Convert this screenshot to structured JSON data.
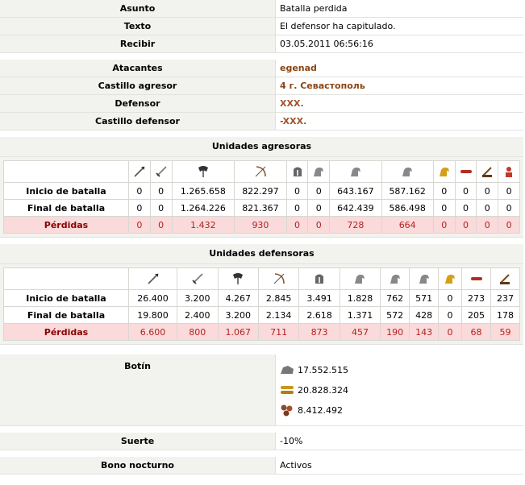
{
  "header": {
    "subject_label": "Asunto",
    "subject_value": "Batalla perdida",
    "text_label": "Texto",
    "text_value": "El defensor ha capitulado.",
    "received_label": "Recibir",
    "received_value": "03.05.2011 06:56:16"
  },
  "battle": {
    "attackers_label": "Atacantes",
    "attackers_value": "egenad",
    "attacker_castle_label": "Castillo agresor",
    "attacker_castle_value": "4 г. Севастополь",
    "defender_label": "Defensor",
    "defender_value": "XXX.",
    "defender_castle_label": "Castillo defensor",
    "defender_castle_value": "-XXX."
  },
  "attack_units": {
    "title": "Unidades agresoras",
    "icons": [
      "spear-icon",
      "sword-icon",
      "axe-icon",
      "bow-icon",
      "helmet-icon",
      "horse-icon",
      "horse-icon",
      "horse-icon",
      "horse-gold-icon",
      "ram-icon",
      "catapult-icon",
      "knight-icon"
    ],
    "rows": [
      {
        "label": "Inicio de batalla",
        "values": [
          "0",
          "0",
          "1.265.658",
          "822.297",
          "0",
          "0",
          "643.167",
          "587.162",
          "0",
          "0",
          "0",
          "0"
        ]
      },
      {
        "label": "Final de batalla",
        "values": [
          "0",
          "0",
          "1.264.226",
          "821.367",
          "0",
          "0",
          "642.439",
          "586.498",
          "0",
          "0",
          "0",
          "0"
        ]
      },
      {
        "label": "Pérdidas",
        "values": [
          "0",
          "0",
          "1.432",
          "930",
          "0",
          "0",
          "728",
          "664",
          "0",
          "0",
          "0",
          "0"
        ]
      }
    ]
  },
  "defense_units": {
    "title": "Unidades defensoras",
    "icons": [
      "spear-icon",
      "sword-icon",
      "axe-icon",
      "bow-icon",
      "helmet-icon",
      "horse-icon",
      "horse-icon",
      "horse-icon",
      "horse-gold-icon",
      "ram-icon",
      "catapult-icon"
    ],
    "rows": [
      {
        "label": "Inicio de batalla",
        "values": [
          "26.400",
          "3.200",
          "4.267",
          "2.845",
          "3.491",
          "1.828",
          "762",
          "571",
          "0",
          "273",
          "237"
        ]
      },
      {
        "label": "Final de batalla",
        "values": [
          "19.800",
          "2.400",
          "3.200",
          "2.134",
          "2.618",
          "1.371",
          "572",
          "428",
          "0",
          "205",
          "178"
        ]
      },
      {
        "label": "Pérdidas",
        "values": [
          "6.600",
          "800",
          "1.067",
          "711",
          "873",
          "457",
          "190",
          "143",
          "0",
          "68",
          "59"
        ]
      }
    ]
  },
  "loot": {
    "label": "Botín",
    "items": [
      {
        "icon": "stone-icon",
        "value": "17.552.515"
      },
      {
        "icon": "wood-icon",
        "value": "20.828.324"
      },
      {
        "icon": "iron-icon",
        "value": "8.412.492"
      }
    ]
  },
  "luck": {
    "label": "Suerte",
    "value": "-10%"
  },
  "night_bonus": {
    "label": "Bono nocturno",
    "value": "Activos"
  }
}
